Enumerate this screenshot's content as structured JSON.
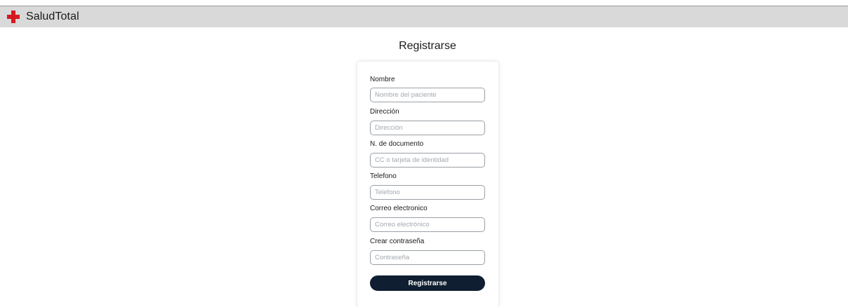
{
  "header": {
    "brand_name": "SaludTotal",
    "logo_icon": "medical-cross-icon",
    "accent_color": "#d71920"
  },
  "page": {
    "title": "Registrarse"
  },
  "form": {
    "fields": [
      {
        "label": "Nombre",
        "placeholder": "Nombre del paciente",
        "value": ""
      },
      {
        "label": "Dirección",
        "placeholder": "Dirección",
        "value": ""
      },
      {
        "label": "N. de documento",
        "placeholder": "CC o tarjeta de identidad",
        "value": ""
      },
      {
        "label": "Telefono",
        "placeholder": "Telefono",
        "value": ""
      },
      {
        "label": "Correo electronico",
        "placeholder": "Correo electrónico",
        "value": ""
      },
      {
        "label": "Crear contraseña",
        "placeholder": "Contraseña",
        "value": ""
      }
    ],
    "submit_label": "Registrarse",
    "submit_color": "#0f1e30"
  }
}
